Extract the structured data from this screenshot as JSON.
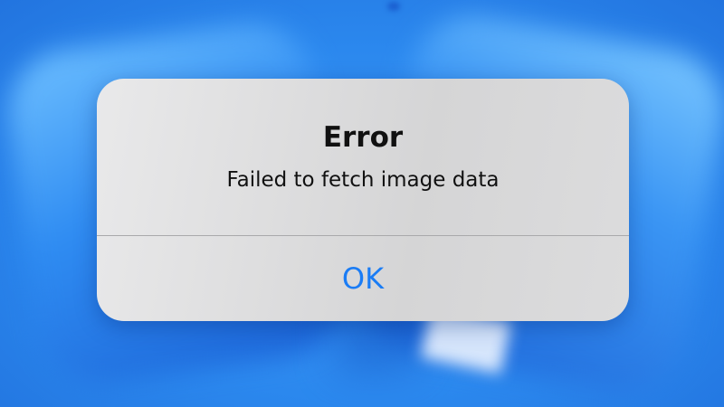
{
  "alert": {
    "title": "Error",
    "message": "Failed to fetch image data",
    "ok_label": "OK"
  },
  "colors": {
    "background": "#2f8df0",
    "alert_surface": "#dcdcdd",
    "text": "#111111",
    "button_text": "#1a7cf5",
    "divider": "#a9a9ab"
  }
}
